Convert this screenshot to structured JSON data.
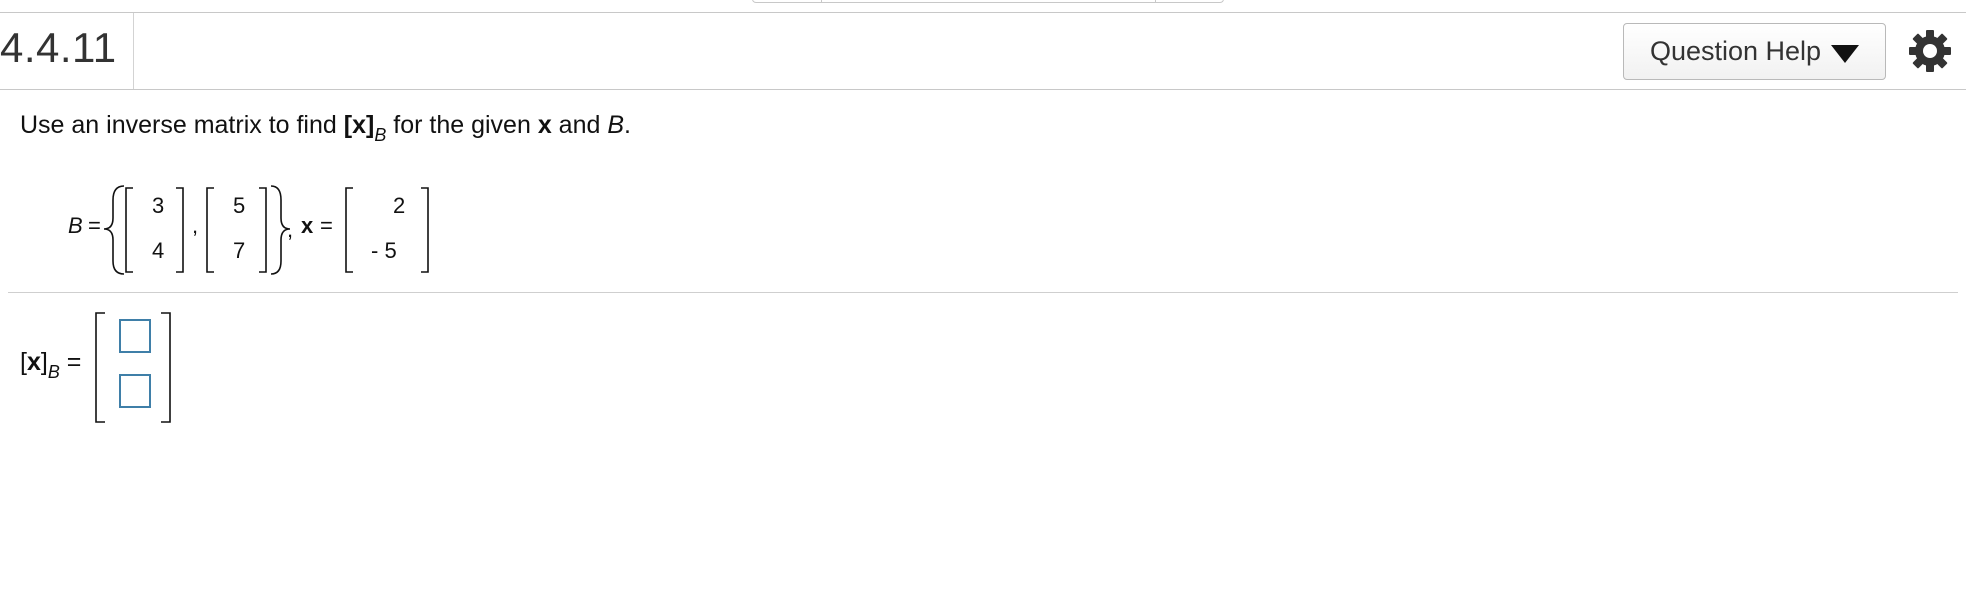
{
  "header": {
    "question_number": "4.4.11",
    "help_button_label": "Question Help"
  },
  "question": {
    "text_prefix": "Use an inverse matrix to find ",
    "bracket_open": "[",
    "x_bold": "x",
    "bracket_close": "]",
    "subscript": "B",
    "text_middle": " for the given ",
    "x_bold_2": "x",
    "text_and": " and ",
    "b_italic": "B",
    "text_end": "."
  },
  "given": {
    "b_label": "B",
    "equals": "=",
    "comma": ",",
    "x_label": "x",
    "vector1": [
      "3",
      "4"
    ],
    "vector2": [
      "5",
      "7"
    ],
    "x_vector": [
      "2",
      "- 5"
    ]
  },
  "answer": {
    "bracket_open": "[",
    "x_bold": "x",
    "bracket_close": "]",
    "subscript": "B",
    "equals": "=",
    "entries": [
      "",
      ""
    ]
  },
  "icons": {
    "gear": "gear-icon",
    "dropdown": "triangle-down-icon"
  }
}
